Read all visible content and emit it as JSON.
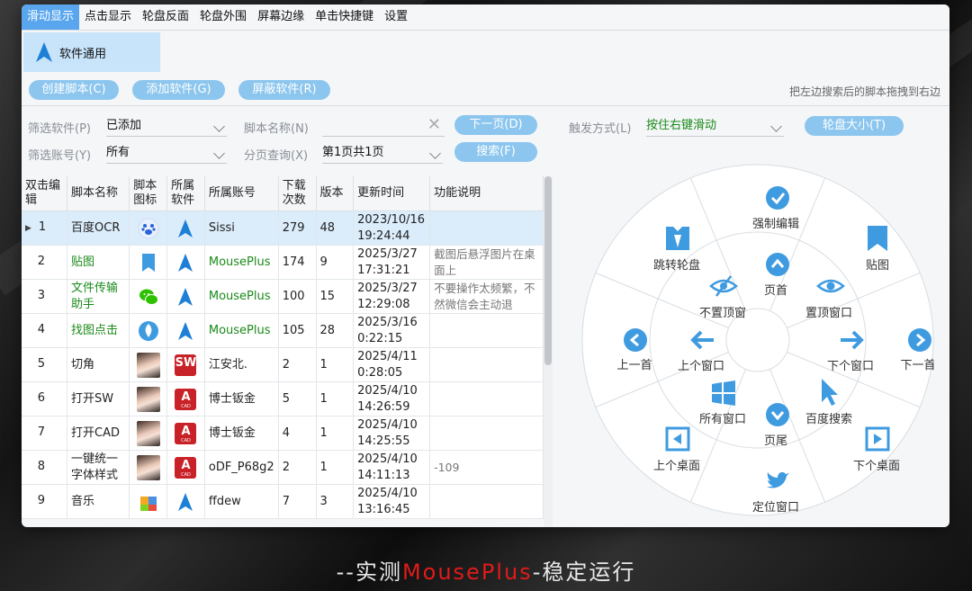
{
  "tabs": [
    "滑动显示",
    "点击显示",
    "轮盘反面",
    "轮盘外围",
    "屏幕边缘",
    "单击快捷键",
    "设置"
  ],
  "category": "软件通用",
  "buttons": {
    "create": "创建脚本(C)",
    "add": "添加软件(G)",
    "block": "屏蔽软件(R)",
    "next_page": "下一页(D)",
    "search": "搜索(F)",
    "wheel_size": "轮盘大小(T)"
  },
  "hint": "把左边搜索后的脚本拖拽到右边",
  "filters": {
    "software_label": "筛选软件(P)",
    "software_value": "已添加",
    "account_label": "筛选账号(Y)",
    "account_value": "所有",
    "script_name_label": "脚本名称(N)",
    "script_name_value": "",
    "page_label": "分页查询(X)",
    "page_value": "第1页共1页",
    "trigger_label": "触发方式(L)",
    "trigger_value": "按住右键滑动"
  },
  "table": {
    "headers": [
      "双击编辑",
      "脚本名称",
      "脚本图标",
      "所属软件",
      "所属账号",
      "下载次数",
      "版本",
      "更新时间",
      "功能说明"
    ],
    "rows": [
      {
        "no": "1",
        "name": "百度OCR",
        "icon": "baidu-paw-icon",
        "soft": "navigation-arrow-icon",
        "account": "Sissi",
        "downloads": "279",
        "version": "48",
        "time": "2023/10/16 19:24:44",
        "desc": "",
        "green": false
      },
      {
        "no": "2",
        "name": "贴图",
        "icon": "bookmark-icon",
        "soft": "navigation-arrow-icon",
        "account": "MousePlus",
        "downloads": "174",
        "version": "9",
        "time": "2025/3/27 17:31:21",
        "desc": "截图后悬浮图片在桌面上",
        "green": true
      },
      {
        "no": "3",
        "name": "文件传输助手",
        "icon": "wechat-icon",
        "soft": "navigation-arrow-icon",
        "account": "MousePlus",
        "downloads": "100",
        "version": "15",
        "time": "2025/3/27 12:29:08",
        "desc": "不要操作太频繁，不然微信会主动退",
        "green": true
      },
      {
        "no": "4",
        "name": "找图点击",
        "icon": "rebel-icon",
        "soft": "navigation-arrow-icon",
        "account": "MousePlus",
        "downloads": "105",
        "version": "28",
        "time": "2025/3/16 0:22:15",
        "desc": "",
        "green": true
      },
      {
        "no": "5",
        "name": "切角",
        "icon": "avatar-photo",
        "soft": "solidworks-icon",
        "account": "江安北.",
        "downloads": "2",
        "version": "1",
        "time": "2025/4/11 0:28:05",
        "desc": "",
        "green": false
      },
      {
        "no": "6",
        "name": "打开SW",
        "icon": "avatar-photo",
        "soft": "autocad-icon",
        "account": "博士钣金",
        "downloads": "5",
        "version": "1",
        "time": "2025/4/10 14:26:59",
        "desc": "",
        "green": false
      },
      {
        "no": "7",
        "name": "打开CAD",
        "icon": "avatar-photo",
        "soft": "autocad-icon",
        "account": "博士钣金",
        "downloads": "4",
        "version": "1",
        "time": "2025/4/10 14:25:55",
        "desc": "",
        "green": false
      },
      {
        "no": "8",
        "name": "一键统一字体样式",
        "icon": "avatar-photo",
        "soft": "autocad-icon",
        "account": "oDF_P68g2",
        "downloads": "2",
        "version": "1",
        "time": "2025/4/10 14:11:13",
        "desc": "-109",
        "green": false
      },
      {
        "no": "9",
        "name": "音乐",
        "icon": "puzzle-icon",
        "soft": "navigation-arrow-icon",
        "account": "ffdew",
        "downloads": "7",
        "version": "3",
        "time": "2025/4/10 13:16:45",
        "desc": "",
        "green": false
      }
    ]
  },
  "wheel": {
    "outer": [
      "强制编辑",
      "贴图",
      "下一首",
      "下个桌面",
      "定位窗口",
      "上个桌面",
      "上一首",
      "跳转轮盘"
    ],
    "inner": [
      "页首",
      "置顶窗口",
      "下个窗口",
      "百度搜索",
      "页尾",
      "所有窗口",
      "上个窗口",
      "不置顶窗"
    ]
  },
  "caption": {
    "prefix": "--实测",
    "brand": "MousePlus",
    "suffix": "-稳定运行"
  },
  "colors": {
    "accent": "#5aa6ee",
    "pill": "#8cc6ee",
    "green": "#1a8a1a",
    "icon_blue": "#3f9be0"
  }
}
